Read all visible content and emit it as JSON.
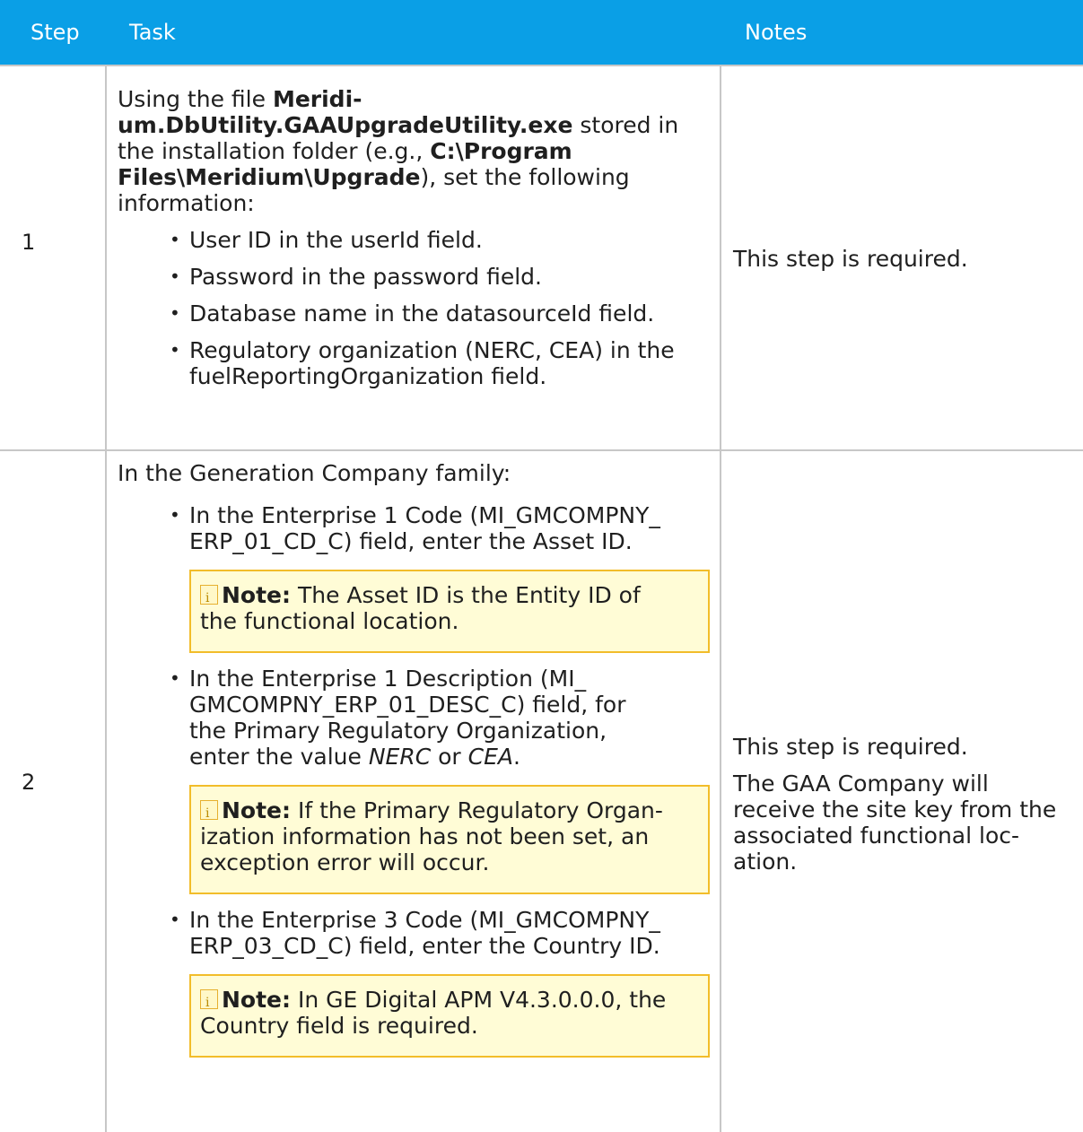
{
  "header": {
    "step": "Step",
    "task": "Task",
    "notes": "Notes"
  },
  "rows": [
    {
      "step": "1",
      "intro": {
        "t1": "Using the file ",
        "file_a": "Meridi-",
        "file_b": "um.DbUtility.GAAUpgradeUtility.exe",
        "t2": " stored in",
        "t3": "the installation folder (e.g., ",
        "path_a": "C:\\Program",
        "path_b": "Files\\Meridium\\Upgrade",
        "t4": "), set the following",
        "t5": "information:"
      },
      "bullets": [
        "User ID in the userId field.",
        "Password in the password field.",
        "Database name in the datasourceId field."
      ],
      "bullet4_a": "Regulatory organization (NERC, CEA) in the",
      "bullet4_b": "fuelReportingOrganization field.",
      "notes": "This step is required."
    },
    {
      "step": "2",
      "intro": "In the Generation Company family:",
      "b1_a": "In the Enterprise 1 Code (MI_GMCOMPNY_",
      "b1_b": "ERP_01_CD_C) field, enter the Asset ID.",
      "note1_label": "Note:",
      "note1_a": " The Asset ID is the Entity ID of",
      "note1_b": "the functional location.",
      "b2_a": "In the Enterprise 1 Description (MI_",
      "b2_b": "GMCOMPNY_ERP_01_DESC_C) field, for",
      "b2_c": "the Primary Regulatory Organization,",
      "b2_d": "enter the value ",
      "b2_v1": "NERC",
      "b2_or": " or ",
      "b2_v2": "CEA",
      "b2_end": ".",
      "note2_label": "Note:",
      "note2_a": " If the Primary Regulatory Organ-",
      "note2_b": "ization information has not been set, an",
      "note2_c": "exception error will occur.",
      "b3_a": "In the Enterprise 3 Code (MI_GMCOMPNY_",
      "b3_b": "ERP_03_CD_C) field, enter the Country ID.",
      "note3_label": "Note:",
      "note3_a": " In GE Digital APM V4.3.0.0.0, the",
      "note3_b": "Country field is required.",
      "notes_1": "This step is required.",
      "notes_2a": "The GAA Company will",
      "notes_2b": "receive the site key from the",
      "notes_2c": "associated functional loc-",
      "notes_2d": "ation."
    }
  ],
  "colors": {
    "header_bg": "#0a9fe6",
    "note_bg": "#fffcd6",
    "note_border": "#f2bd2a",
    "grid": "#c7c7c7"
  }
}
